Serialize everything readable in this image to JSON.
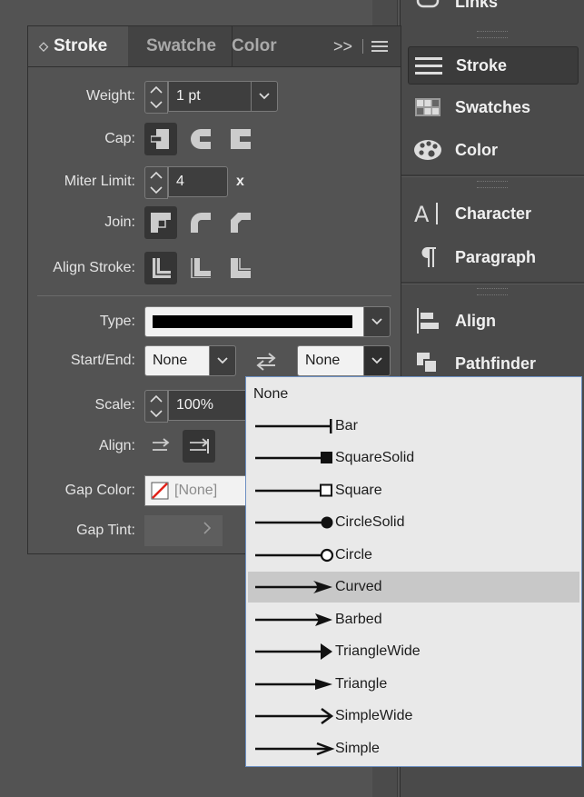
{
  "dock": {
    "top_partial": "Links",
    "items": [
      {
        "label": "Stroke",
        "icon": "stroke-lines-icon",
        "active": true
      },
      {
        "label": "Swatches",
        "icon": "swatches-grid-icon"
      },
      {
        "label": "Color",
        "icon": "palette-icon"
      },
      {
        "label": "Character",
        "icon": "character-icon"
      },
      {
        "label": "Paragraph",
        "icon": "pilcrow-icon"
      },
      {
        "label": "Align",
        "icon": "align-left-icon"
      },
      {
        "label": "Pathfinder",
        "icon": "pathfinder-icon"
      }
    ]
  },
  "panel": {
    "tabs": [
      {
        "label": "Stroke",
        "active": true
      },
      {
        "label": "Swatche"
      },
      {
        "label": "Color"
      }
    ],
    "menu_glyph": ">>",
    "weight": {
      "label": "Weight:",
      "value": "1 pt"
    },
    "cap": {
      "label": "Cap:"
    },
    "miter": {
      "label": "Miter Limit:",
      "value": "4",
      "unit": "x"
    },
    "join": {
      "label": "Join:"
    },
    "align_stroke": {
      "label": "Align Stroke:"
    },
    "type": {
      "label": "Type:"
    },
    "start_end": {
      "label": "Start/End:",
      "start": "None",
      "end": "None"
    },
    "scale": {
      "label": "Scale:",
      "value": "100%"
    },
    "align": {
      "label": "Align:"
    },
    "gap_color": {
      "label": "Gap Color:",
      "value": "[None]"
    },
    "gap_tint": {
      "label": "Gap Tint:"
    }
  },
  "menu": {
    "items": [
      "None",
      "Bar",
      "SquareSolid",
      "Square",
      "CircleSolid",
      "Circle",
      "Curved",
      "Barbed",
      "TriangleWide",
      "Triangle",
      "SimpleWide",
      "Simple"
    ],
    "highlighted": "Curved"
  },
  "colors": {
    "panel_bg": "#535353",
    "menu_bg": "#e9e9e9",
    "menu_highlight": "#c8c8c8",
    "menu_border": "#6c8fc2"
  }
}
